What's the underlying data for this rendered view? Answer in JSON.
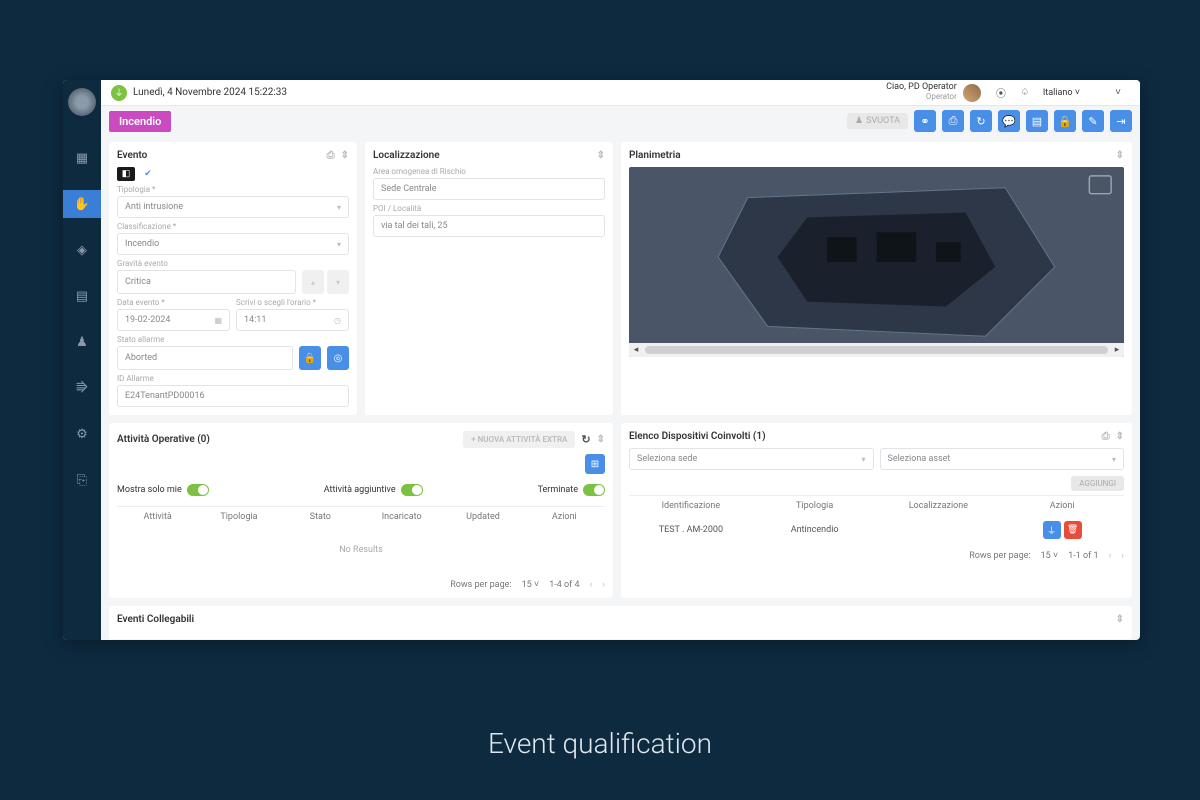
{
  "caption": "Event qualification",
  "topbar": {
    "datetime": "Lunedì, 4 Novembre 2024 15:22:33",
    "greeting": "Ciao, PD Operator",
    "role": "Operator",
    "language": "Italiano"
  },
  "tagbar": {
    "tag": "Incendio",
    "svuota": "SVUOTA"
  },
  "evento": {
    "title": "Evento",
    "tipologia_label": "Tipologia *",
    "tipologia": "Anti intrusione",
    "classificazione_label": "Classificazione *",
    "classificazione": "Incendio",
    "gravita_label": "Gravità evento",
    "gravita": "Critica",
    "data_label": "Data evento *",
    "data": "19-02-2024",
    "ora_label": "Scrivi o scegli l'orario *",
    "ora": "14:11",
    "stato_label": "Stato allarme",
    "stato": "Aborted",
    "id_label": "ID Allarme",
    "id": "E24TenantPD00016"
  },
  "local": {
    "title": "Localizzazione",
    "area_label": "Area omogenea di Rischio",
    "area": "Sede Centrale",
    "poi_label": "POI / Località",
    "poi": "via tal dei tali, 25"
  },
  "plan": {
    "title": "Planimetria"
  },
  "attivita": {
    "title": "Attività Operative (0)",
    "nuova": "+ NUOVA ATTIVITÀ EXTRA",
    "toggle1": "Mostra solo mie",
    "toggle2": "Attività aggiuntive",
    "toggle3": "Terminate",
    "cols": [
      "Attività",
      "Tipologia",
      "Stato",
      "Incaricato",
      "Updated",
      "Azioni"
    ],
    "noresults": "No Results",
    "rows_label": "Rows per page:",
    "rows_per_page": "15",
    "range": "1-4 of 4"
  },
  "elenco": {
    "title": "Elenco Dispositivi Coinvolti (1)",
    "sede_placeholder": "Seleziona sede",
    "asset_placeholder": "Seleziona asset",
    "aggiungi": "AGGIUNGI",
    "cols": [
      "Identificazione",
      "Tipologia",
      "Localizzazione",
      "Azioni"
    ],
    "row": {
      "id": "TEST . AM-2000",
      "tipo": "Antincendio",
      "loc": ""
    },
    "rows_label": "Rows per page:",
    "rows_per_page": "15",
    "range": "1-1 of 1"
  },
  "collegabili": {
    "title": "Eventi Collegabili"
  }
}
